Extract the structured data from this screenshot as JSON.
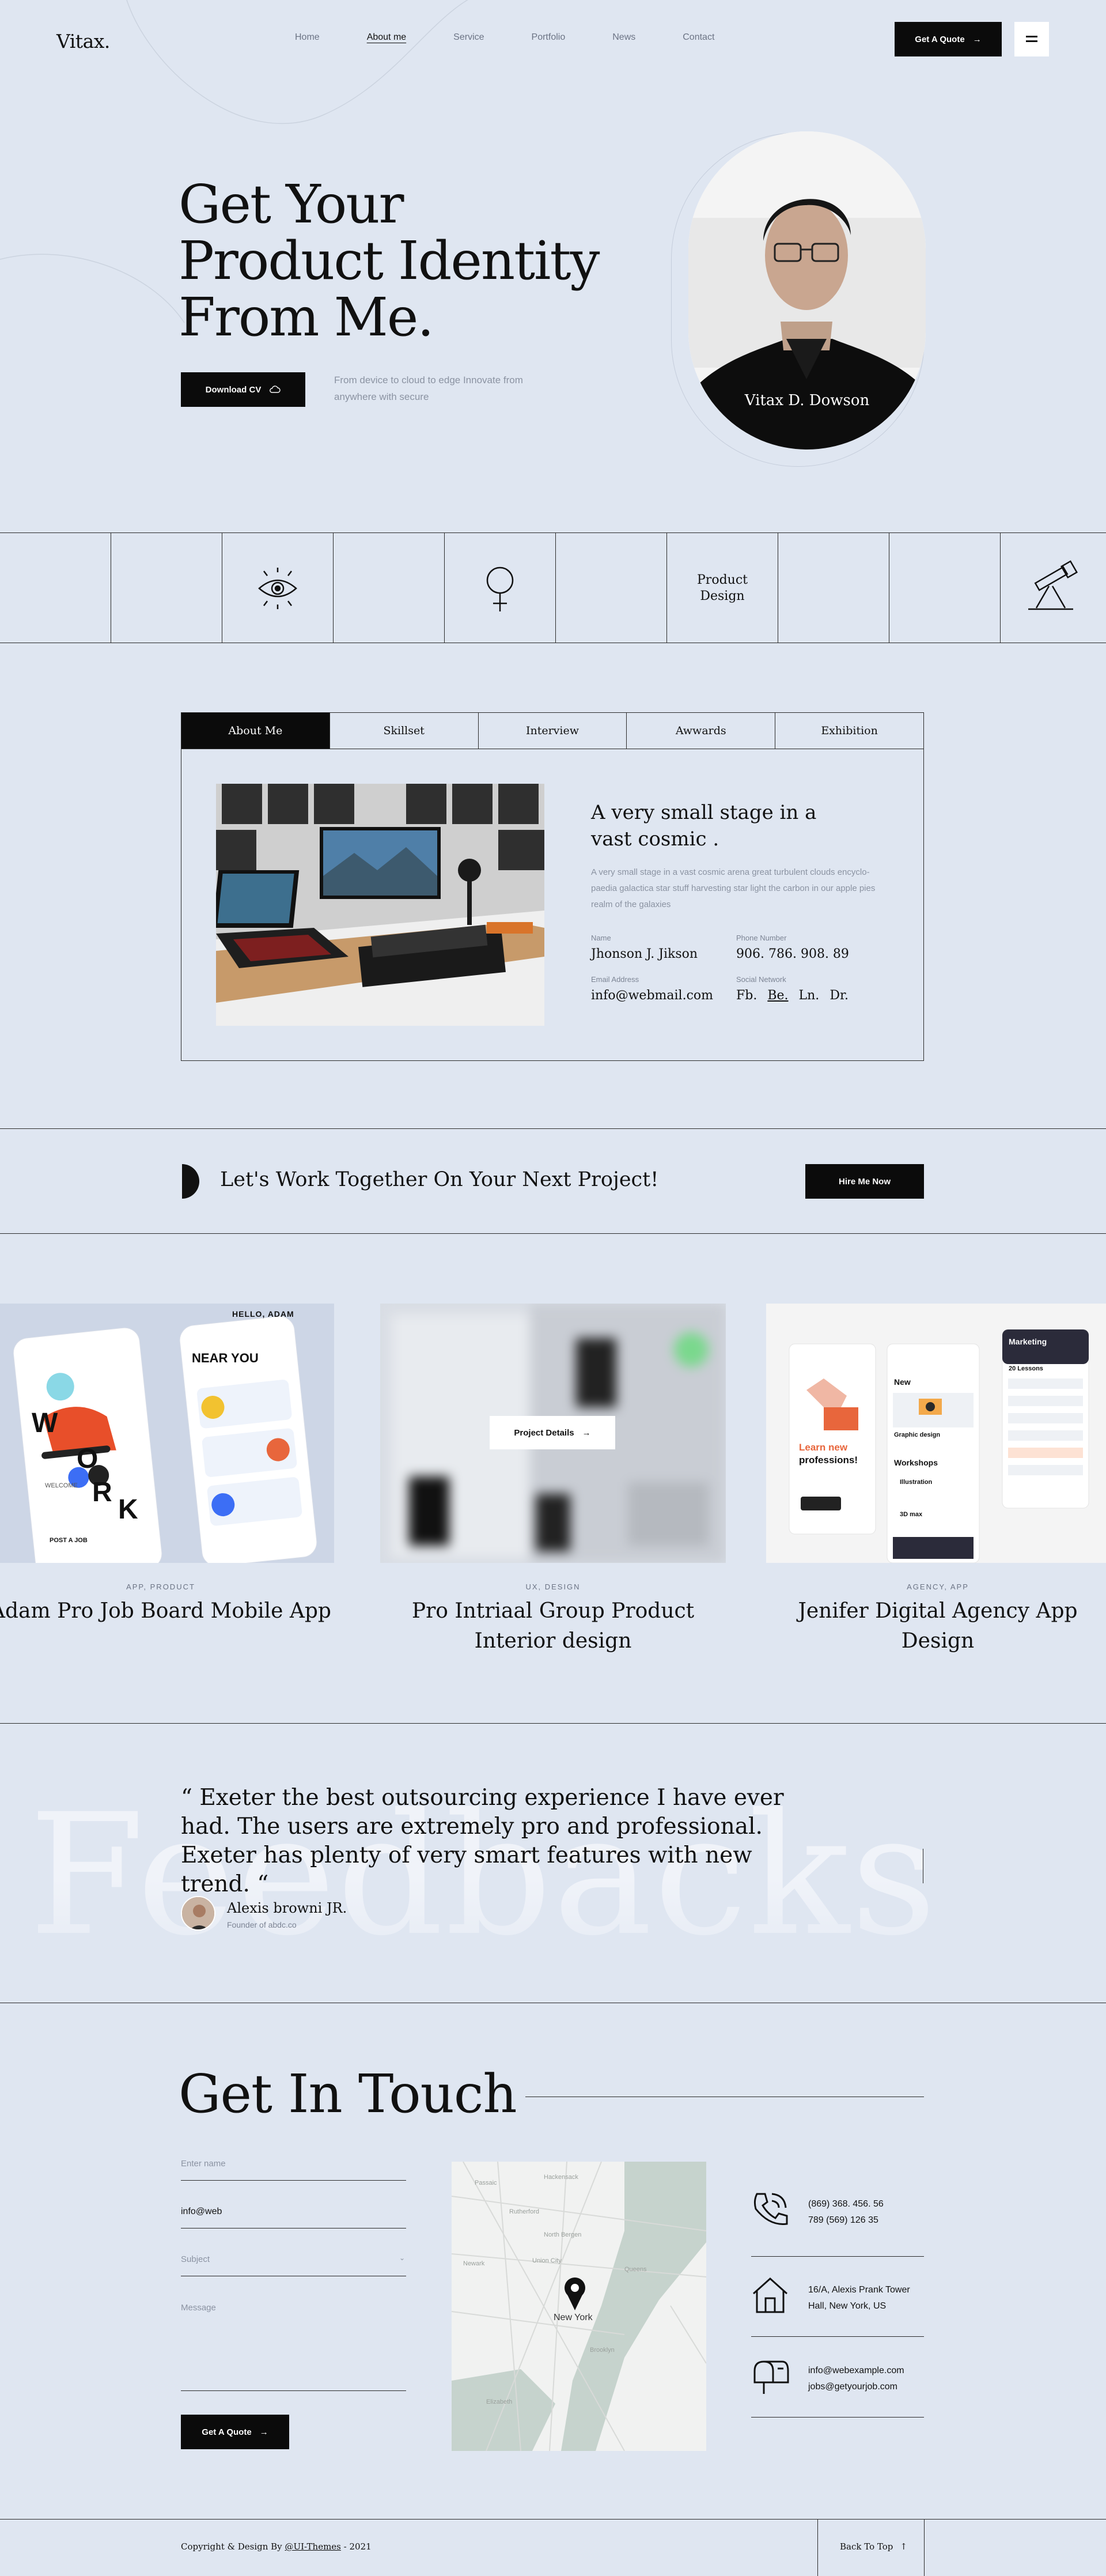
{
  "header": {
    "logo": "Vitax.",
    "nav": [
      "Home",
      "About me",
      "Service",
      "Portfolio",
      "News",
      "Contact"
    ],
    "cta": "Get A Quote"
  },
  "hero": {
    "title_lines": [
      "Get Your",
      "Product Identity",
      "From Me."
    ],
    "download_label": "Download CV",
    "subtitle": "From device to cloud to edge Innovate from anywhere with secure",
    "portrait_name": "Vitax D. Dowson"
  },
  "strip": {
    "label": "Product\nDesign",
    "icons": [
      "eye-icon",
      "venus-icon",
      "telescope-icon"
    ]
  },
  "about": {
    "tabs": [
      "About Me",
      "Skillset",
      "Interview",
      "Awwards",
      "Exhibition"
    ],
    "heading": "A very small stage in a vast cosmic .",
    "body": "A very small stage in a vast cosmic arena great turbulent clouds encyclo-paedia galactica star stuff harvesting star light the carbon in our apple pies realm of the galaxies",
    "name_label": "Name",
    "name": "Jhonson J. Jikson",
    "phone_label": "Phone Number",
    "phone": "906. 786. 908. 89",
    "email_label": "Email Address",
    "email": "info@webmail.com",
    "social_label": "Social Network",
    "social": [
      "Fb.",
      "Be.",
      "Ln.",
      "Dr."
    ]
  },
  "cta_band": {
    "text": "Let's Work Together On Your Next Project!",
    "button": "Hire Me Now"
  },
  "portfolio": [
    {
      "category": "APP, PRODUCT",
      "title": "Adam Pro Job Board Mobile App"
    },
    {
      "category": "UX, DESIGN",
      "title": "Pro Intriaal Group Product Interior design",
      "overlay": "Project Details"
    },
    {
      "category": "AGENCY, APP",
      "title": "Jenifer Digital Agency App Design"
    }
  ],
  "mockups": {
    "app1": {
      "hello": "HELLO, ADAM",
      "near_you": "NEAR YOU",
      "work_letters": [
        "W",
        "O",
        "R",
        "K"
      ],
      "welcome": "WELCOME",
      "post_job": "POST A JOB"
    },
    "app3": {
      "learn_new": "Learn new",
      "professions": "professions!",
      "new": "New",
      "workshops": "Workshops",
      "marketing": "Marketing",
      "lessons": "20 Lessons",
      "graphic_design": "Graphic design",
      "illustration": "Illustration",
      "3d_max": "3D max"
    }
  },
  "feedback": {
    "watermark": "Feedbacks",
    "quote": "“ Exeter the best outsourcing experience I have ever had. The users are extremely pro and professional. Exeter has plenty of very smart features with new trend. “",
    "author": "Alexis browni JR.",
    "author_role": "Founder of abdc.co"
  },
  "contact": {
    "title": "Get In Touch",
    "name_placeholder": "Enter name",
    "email_value": "info@web",
    "subject_placeholder": "Subject",
    "message_placeholder": "Message",
    "submit": "Get A Quote",
    "map_label": "New York",
    "phone_lines": [
      "(869) 368. 456. 56",
      "789 (569) 126 35"
    ],
    "address_lines": [
      "16/A, Alexis Prank Tower",
      "Hall, New York, US"
    ],
    "email_lines": [
      "info@webexample.com",
      "jobs@getyourjob.com"
    ]
  },
  "footer": {
    "copyright_prefix": "Copyright & Design By ",
    "copyright_link": "@UI-Themes",
    "copyright_suffix": " - 2021",
    "back_to_top": "Back To Top"
  }
}
